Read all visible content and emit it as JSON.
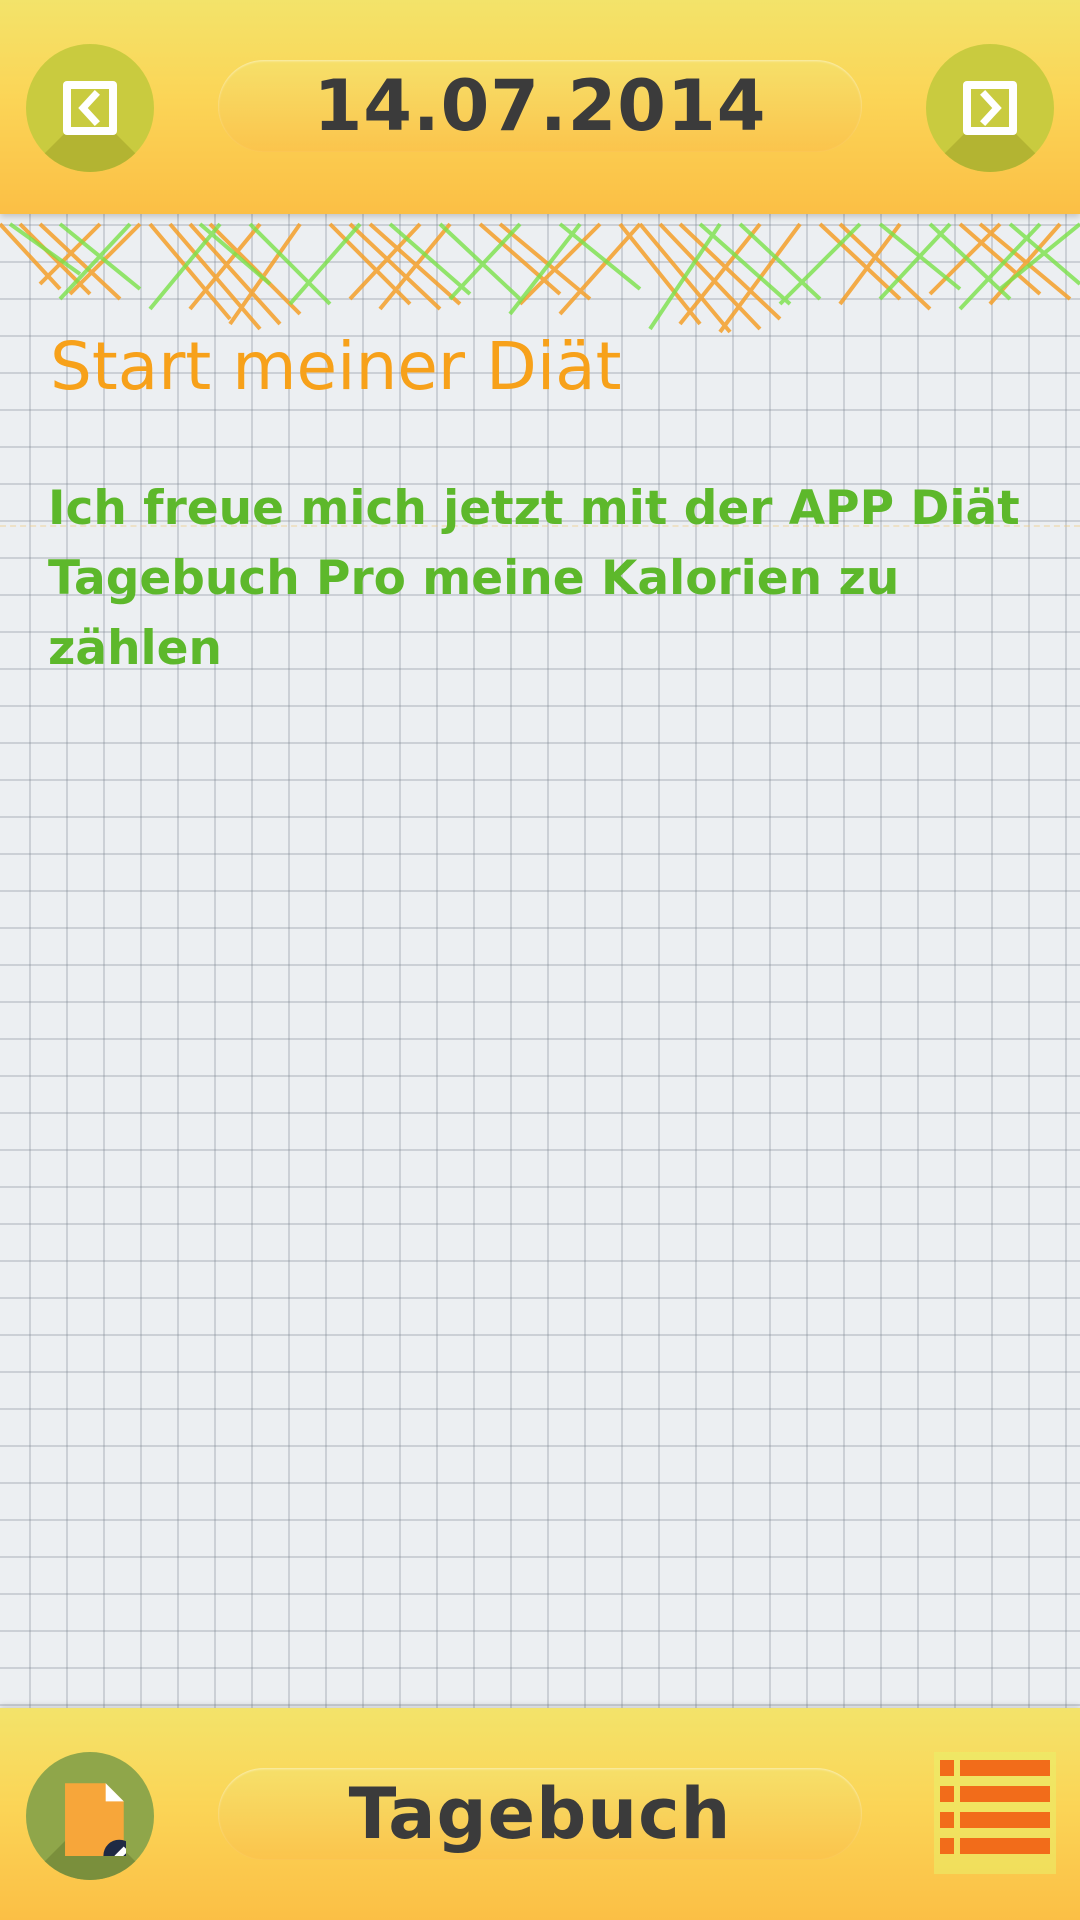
{
  "header": {
    "date": "14.07.2014"
  },
  "entry": {
    "title": "Start meiner Diät",
    "text": "Ich freue mich jetzt mit der APP Diät Tagebuch Pro meine Kalorien zu zählen"
  },
  "footer": {
    "label": "Tagebuch"
  },
  "icons": {
    "prev": "chevron-left-icon",
    "next": "chevron-right-icon",
    "edit": "edit-note-icon",
    "list": "list-icon"
  },
  "colors": {
    "bar_yellow": "#f3e36a",
    "bar_orange": "#fbbf45",
    "round_button": "#c9cb3f",
    "title_orange": "#f7a11a",
    "text_green": "#5db82b",
    "list_orange": "#f26c1a"
  }
}
